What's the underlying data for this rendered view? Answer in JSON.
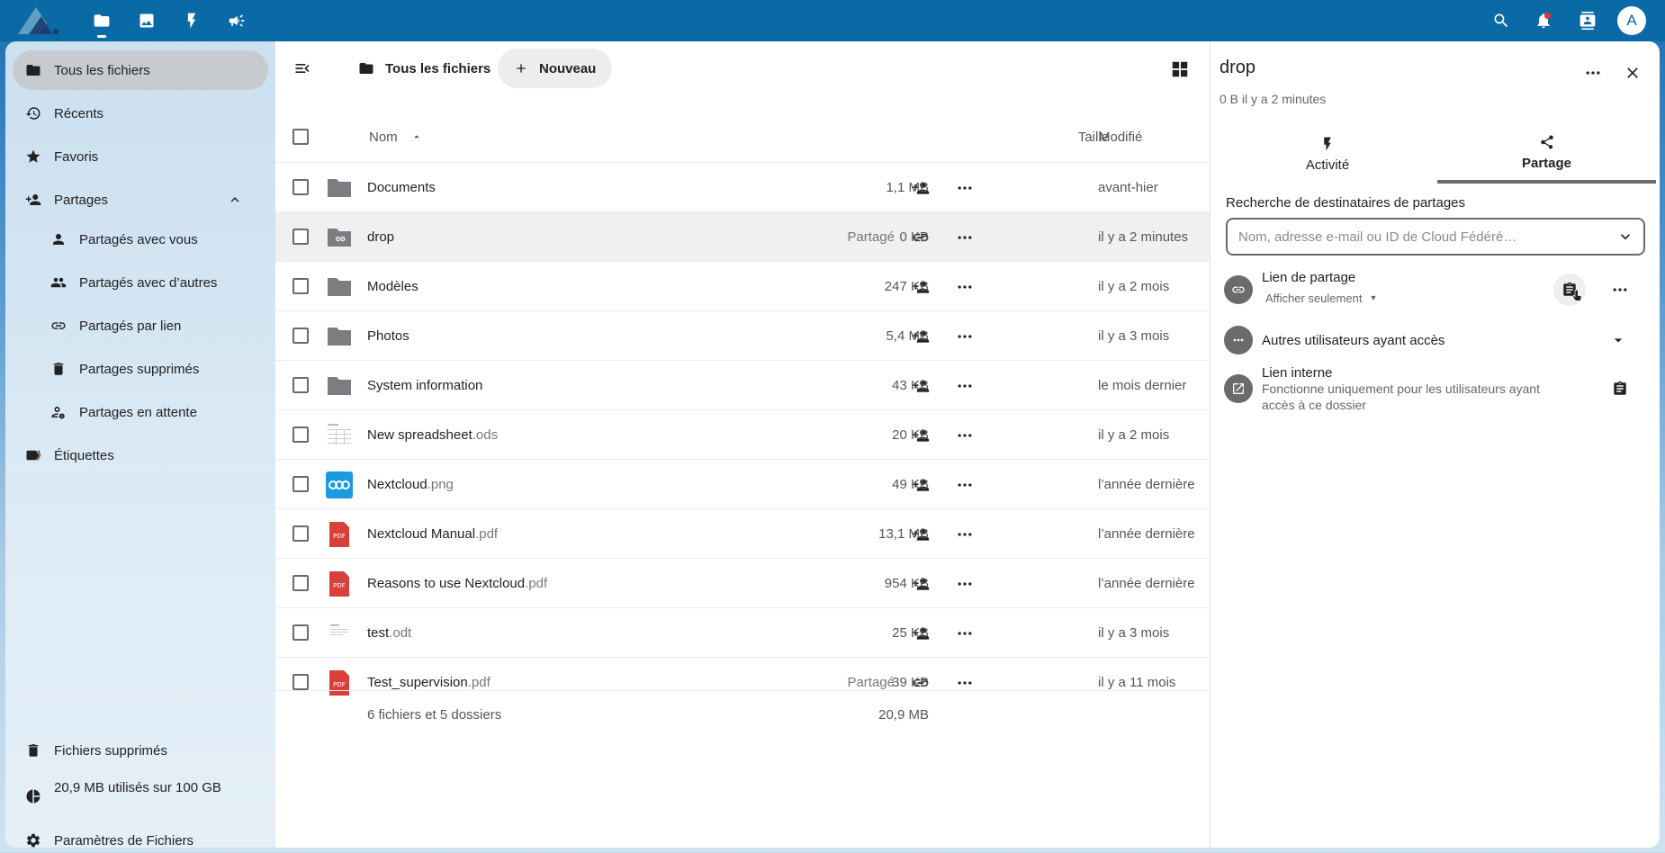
{
  "topbar": {
    "apps": [
      "files-icon",
      "photos-icon",
      "activity-icon",
      "announcements-icon"
    ],
    "right_icons": [
      "search-icon",
      "bell-icon",
      "contacts-icon"
    ],
    "avatar_initial": "A"
  },
  "sidebar": {
    "items": [
      {
        "label": "Tous les fichiers",
        "icon": "folder-icon"
      },
      {
        "label": "Récents",
        "icon": "history-icon"
      },
      {
        "label": "Favoris",
        "icon": "star-icon"
      },
      {
        "label": "Partages",
        "icon": "share-icon"
      },
      {
        "label": "Partagés avec vous",
        "icon": "user-icon"
      },
      {
        "label": "Partagés avec d’autres",
        "icon": "users-icon"
      },
      {
        "label": "Partagés par lien",
        "icon": "link-icon"
      },
      {
        "label": "Partages supprimés",
        "icon": "trash-icon"
      },
      {
        "label": "Partages en attente",
        "icon": "pending-icon"
      },
      {
        "label": "Étiquettes",
        "icon": "tag-icon"
      }
    ],
    "bottom": {
      "deleted": "Fichiers supprimés",
      "quota": "20,9 MB utilisés sur 100 GB",
      "settings": "Paramètres de Fichiers"
    }
  },
  "toolbar": {
    "breadcrumb": "Tous les fichiers",
    "new_label": "Nouveau"
  },
  "table": {
    "headers": {
      "name": "Nom",
      "size": "Taille",
      "modified": "Modifié"
    },
    "rows": [
      {
        "name": "Documents",
        "ext": "",
        "type": "folder",
        "shared": "",
        "size": "1,1 MB",
        "modified": "avant-hier"
      },
      {
        "name": "drop",
        "ext": "",
        "type": "folder-link",
        "shared": "Partagé",
        "size": "0 KB",
        "modified": "il y a 2 minutes"
      },
      {
        "name": "Modèles",
        "ext": "",
        "type": "folder",
        "shared": "",
        "size": "247 KB",
        "modified": "il y a 2 mois"
      },
      {
        "name": "Photos",
        "ext": "",
        "type": "folder",
        "shared": "",
        "size": "5,4 MB",
        "modified": "il y a 3 mois"
      },
      {
        "name": "System information",
        "ext": "",
        "type": "folder",
        "shared": "",
        "size": "43 KB",
        "modified": "le mois dernier"
      },
      {
        "name": "New spreadsheet",
        "ext": ".ods",
        "type": "sheet",
        "shared": "",
        "size": "20 KB",
        "modified": "il y a 2 mois"
      },
      {
        "name": "Nextcloud",
        "ext": ".png",
        "type": "image",
        "shared": "",
        "size": "49 KB",
        "modified": "l’année dernière"
      },
      {
        "name": "Nextcloud Manual",
        "ext": ".pdf",
        "type": "pdf",
        "shared": "",
        "size": "13,1 MB",
        "modified": "l’année dernière"
      },
      {
        "name": "Reasons to use Nextcloud",
        "ext": ".pdf",
        "type": "pdf",
        "shared": "",
        "size": "954 KB",
        "modified": "l’année dernière"
      },
      {
        "name": "test",
        "ext": ".odt",
        "type": "doc",
        "shared": "",
        "size": "25 KB",
        "modified": "il y a 3 mois"
      },
      {
        "name": "Test_supervision",
        "ext": ".pdf",
        "type": "pdf",
        "shared": "Partagé",
        "size": "39 KB",
        "modified": "il y a 11 mois"
      }
    ],
    "summary": {
      "count": "6 fichiers et 5 dossiers",
      "total": "20,9 MB"
    }
  },
  "details": {
    "title": "drop",
    "subtitle": "0 B il y a 2 minutes",
    "tabs": [
      "Activité",
      "Partage"
    ],
    "search_label": "Recherche de destinataires de partages",
    "search_placeholder": "Nom, adresse e-mail ou ID de Cloud Fédéré…",
    "link_share": {
      "title": "Lien de partage",
      "permission": "Afficher seulement"
    },
    "others": "Autres utilisateurs ayant accès",
    "internal_link": {
      "title": "Lien interne",
      "desc_line1": "Fonctionne uniquement pour les utilisateurs ayant",
      "desc_line2": "accès à ce dossier"
    }
  }
}
